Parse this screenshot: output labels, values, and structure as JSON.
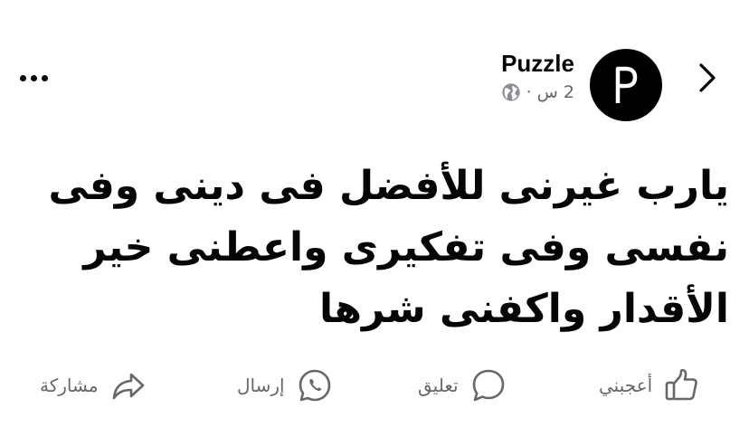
{
  "post": {
    "author": "Puzzle",
    "avatar_letter": "P",
    "time": "2 س",
    "separator": "·",
    "text": "يارب غيرنى للأفضل فى دينى وفى نفسى وفى تفكيرى واعطنى خير الأقدار واكفنى شرها"
  },
  "actions": {
    "like": "أعجبني",
    "comment": "تعليق",
    "send": "إرسال",
    "share": "مشاركة"
  },
  "icons": {
    "more": "more-options-icon",
    "back": "chevron-right-icon",
    "audience": "globe-icon",
    "like": "thumbs-up-icon",
    "comment": "comment-icon",
    "send": "whatsapp-icon",
    "share": "share-arrow-icon"
  },
  "colors": {
    "text": "#050505",
    "secondary": "#65676b",
    "avatar_bg": "#000000"
  }
}
